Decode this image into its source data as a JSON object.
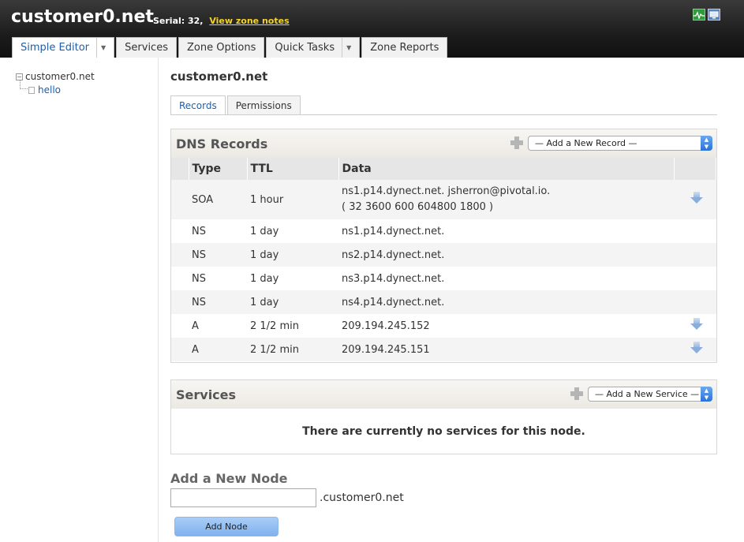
{
  "header": {
    "zone_name": "customer0.net",
    "serial_label": "Serial: 32,",
    "zone_notes_link": "View zone notes"
  },
  "top_tabs": [
    {
      "label": "Simple Editor",
      "has_dropdown": true,
      "active": true
    },
    {
      "label": "Services",
      "has_dropdown": false
    },
    {
      "label": "Zone Options",
      "has_dropdown": false
    },
    {
      "label": "Quick Tasks",
      "has_dropdown": true
    },
    {
      "label": "Zone Reports",
      "has_dropdown": false
    }
  ],
  "tree": {
    "root": "customer0.net",
    "children": [
      "hello"
    ]
  },
  "main": {
    "node_title": "customer0.net",
    "subtabs": [
      "Records",
      "Permissions"
    ]
  },
  "dns_records": {
    "title": "DNS Records",
    "add_select": "— Add a New Record —",
    "columns": [
      "Type",
      "TTL",
      "Data"
    ],
    "rows": [
      {
        "type": "SOA",
        "ttl": "1 hour",
        "data": "ns1.p14.dynect.net. jsherron@pivotal.io.",
        "data2": "( 32 3600 600 604800 1800 )"
      },
      {
        "type": "NS",
        "ttl": "1 day",
        "data": "ns1.p14.dynect.net."
      },
      {
        "type": "NS",
        "ttl": "1 day",
        "data": "ns2.p14.dynect.net."
      },
      {
        "type": "NS",
        "ttl": "1 day",
        "data": "ns3.p14.dynect.net."
      },
      {
        "type": "NS",
        "ttl": "1 day",
        "data": "ns4.p14.dynect.net."
      },
      {
        "type": "A",
        "ttl": "2 1/2 min",
        "data": "209.194.245.152"
      },
      {
        "type": "A",
        "ttl": "2 1/2 min",
        "data": "209.194.245.151"
      }
    ]
  },
  "services": {
    "title": "Services",
    "add_select": "— Add a New Service —",
    "empty_message": "There are currently no services for this node."
  },
  "add_node": {
    "title": "Add a New Node",
    "input_value": "",
    "suffix": ".customer0.net",
    "button": "Add Node"
  }
}
